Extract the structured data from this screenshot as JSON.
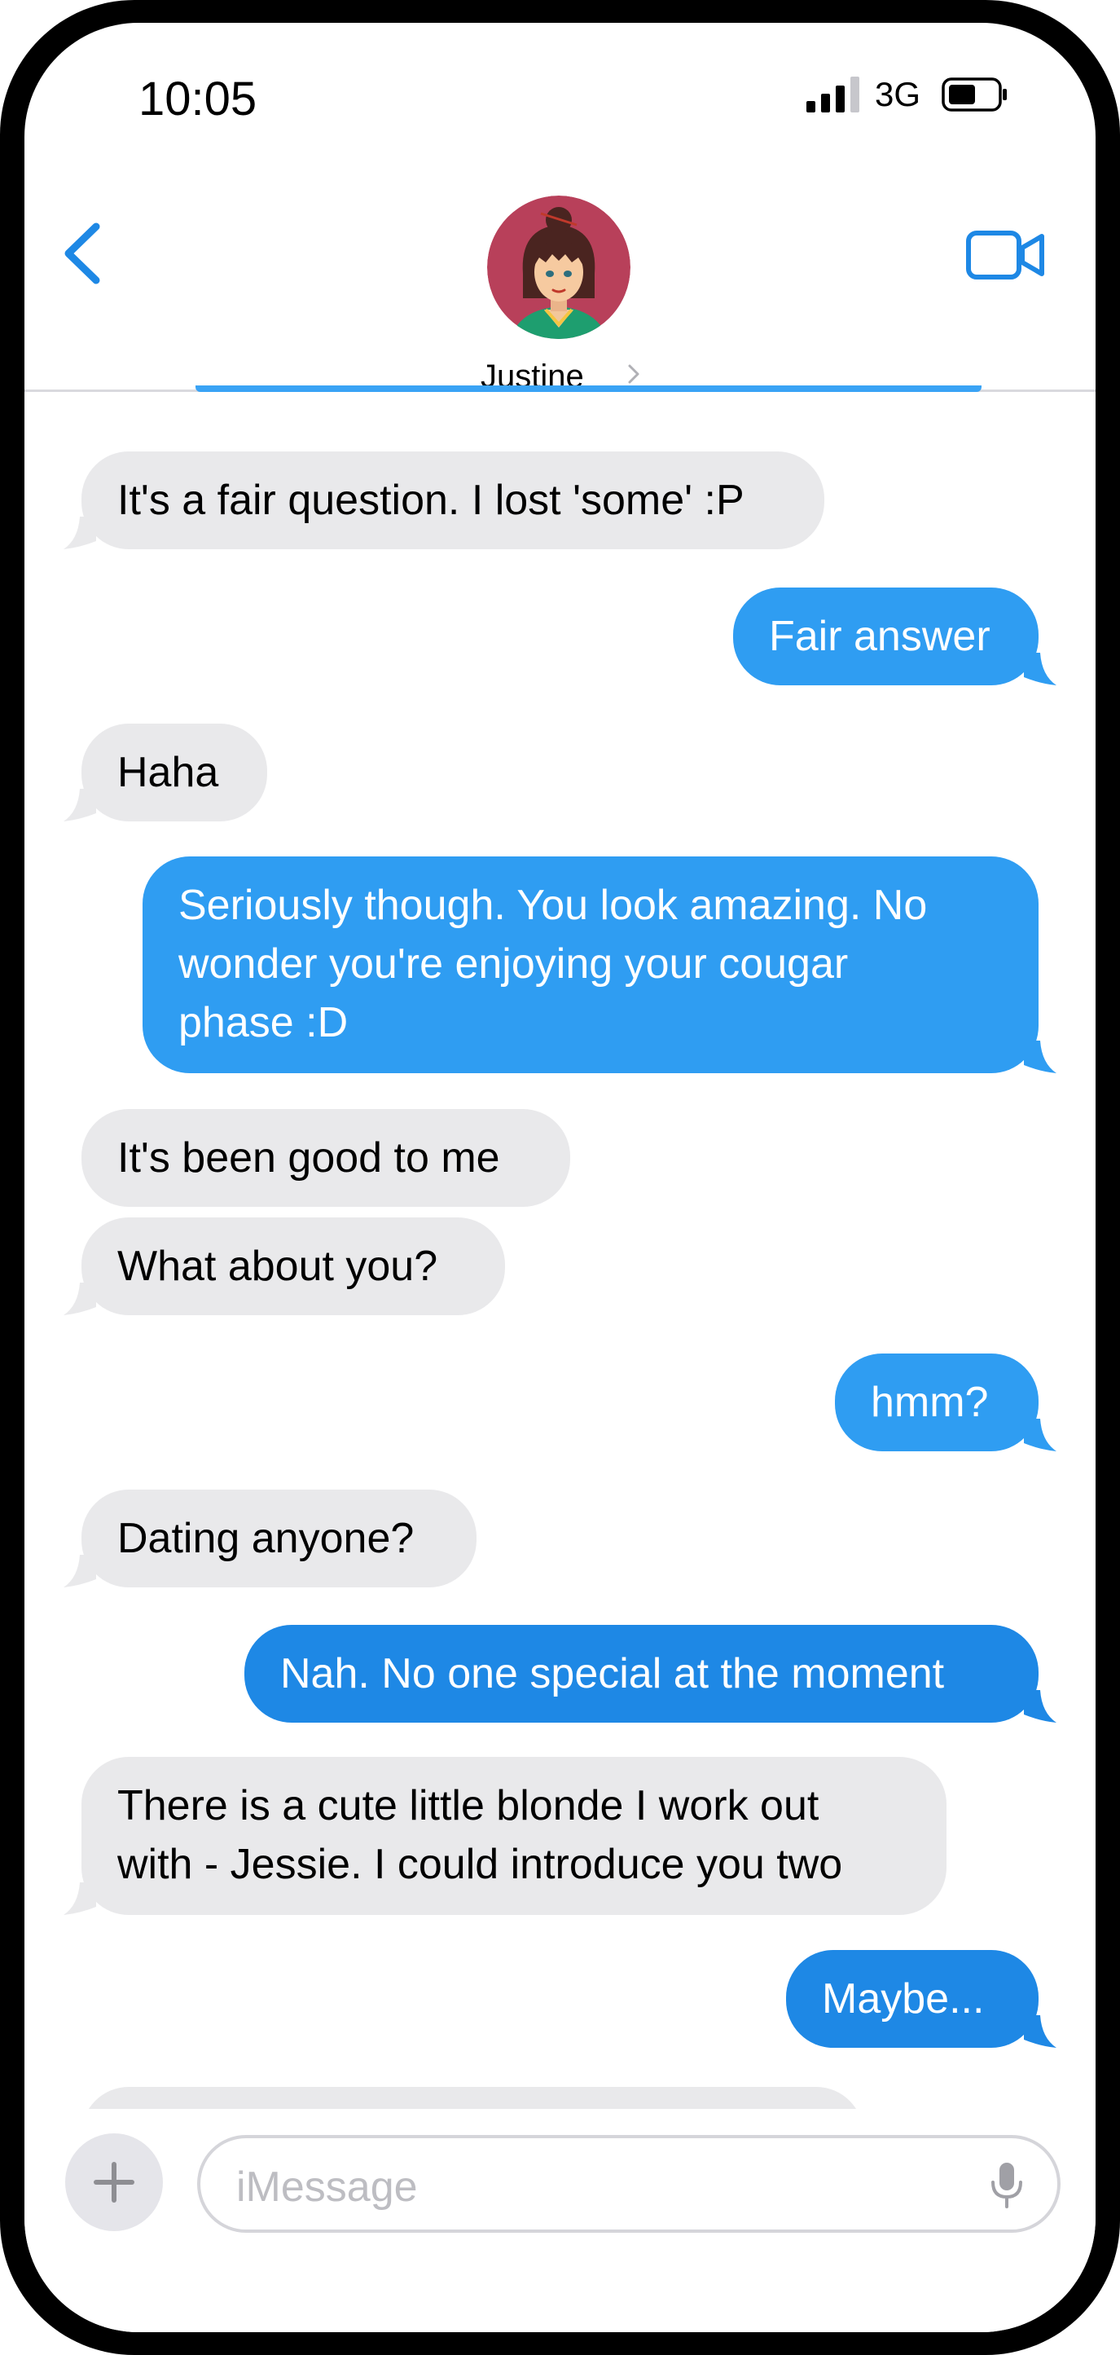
{
  "status_bar": {
    "time": "10:05",
    "network": "3G"
  },
  "header": {
    "contact_name": "Justine"
  },
  "messages": [
    {
      "from": "them",
      "text": "It's a fair question.  I lost 'some' :P"
    },
    {
      "from": "me",
      "text": "Fair answer"
    },
    {
      "from": "them",
      "text": "Haha"
    },
    {
      "from": "me",
      "lines": [
        "Seriously though.  You look amazing.  No",
        "wonder you're enjoying your cougar",
        "phase :D"
      ]
    },
    {
      "from": "them",
      "text": "It's been good to me"
    },
    {
      "from": "them",
      "text": "What about you?"
    },
    {
      "from": "me",
      "text": "hmm?"
    },
    {
      "from": "them",
      "text": "Dating anyone?"
    },
    {
      "from": "me",
      "text": "Nah.  No one special at the moment"
    },
    {
      "from": "them",
      "lines": [
        "There is a cute little blonde I work out",
        "with - Jessie.  I could introduce you two"
      ]
    },
    {
      "from": "me",
      "text": "Maybe..."
    }
  ],
  "input": {
    "placeholder": "iMessage"
  },
  "colors": {
    "accent": "#1e88e5",
    "sent_bubble": "#2f9df2",
    "received_bubble": "#e9e9eb"
  },
  "icons": {
    "back": "chevron-left-icon",
    "video": "video-camera-icon",
    "plus": "plus-icon",
    "mic": "microphone-icon"
  }
}
